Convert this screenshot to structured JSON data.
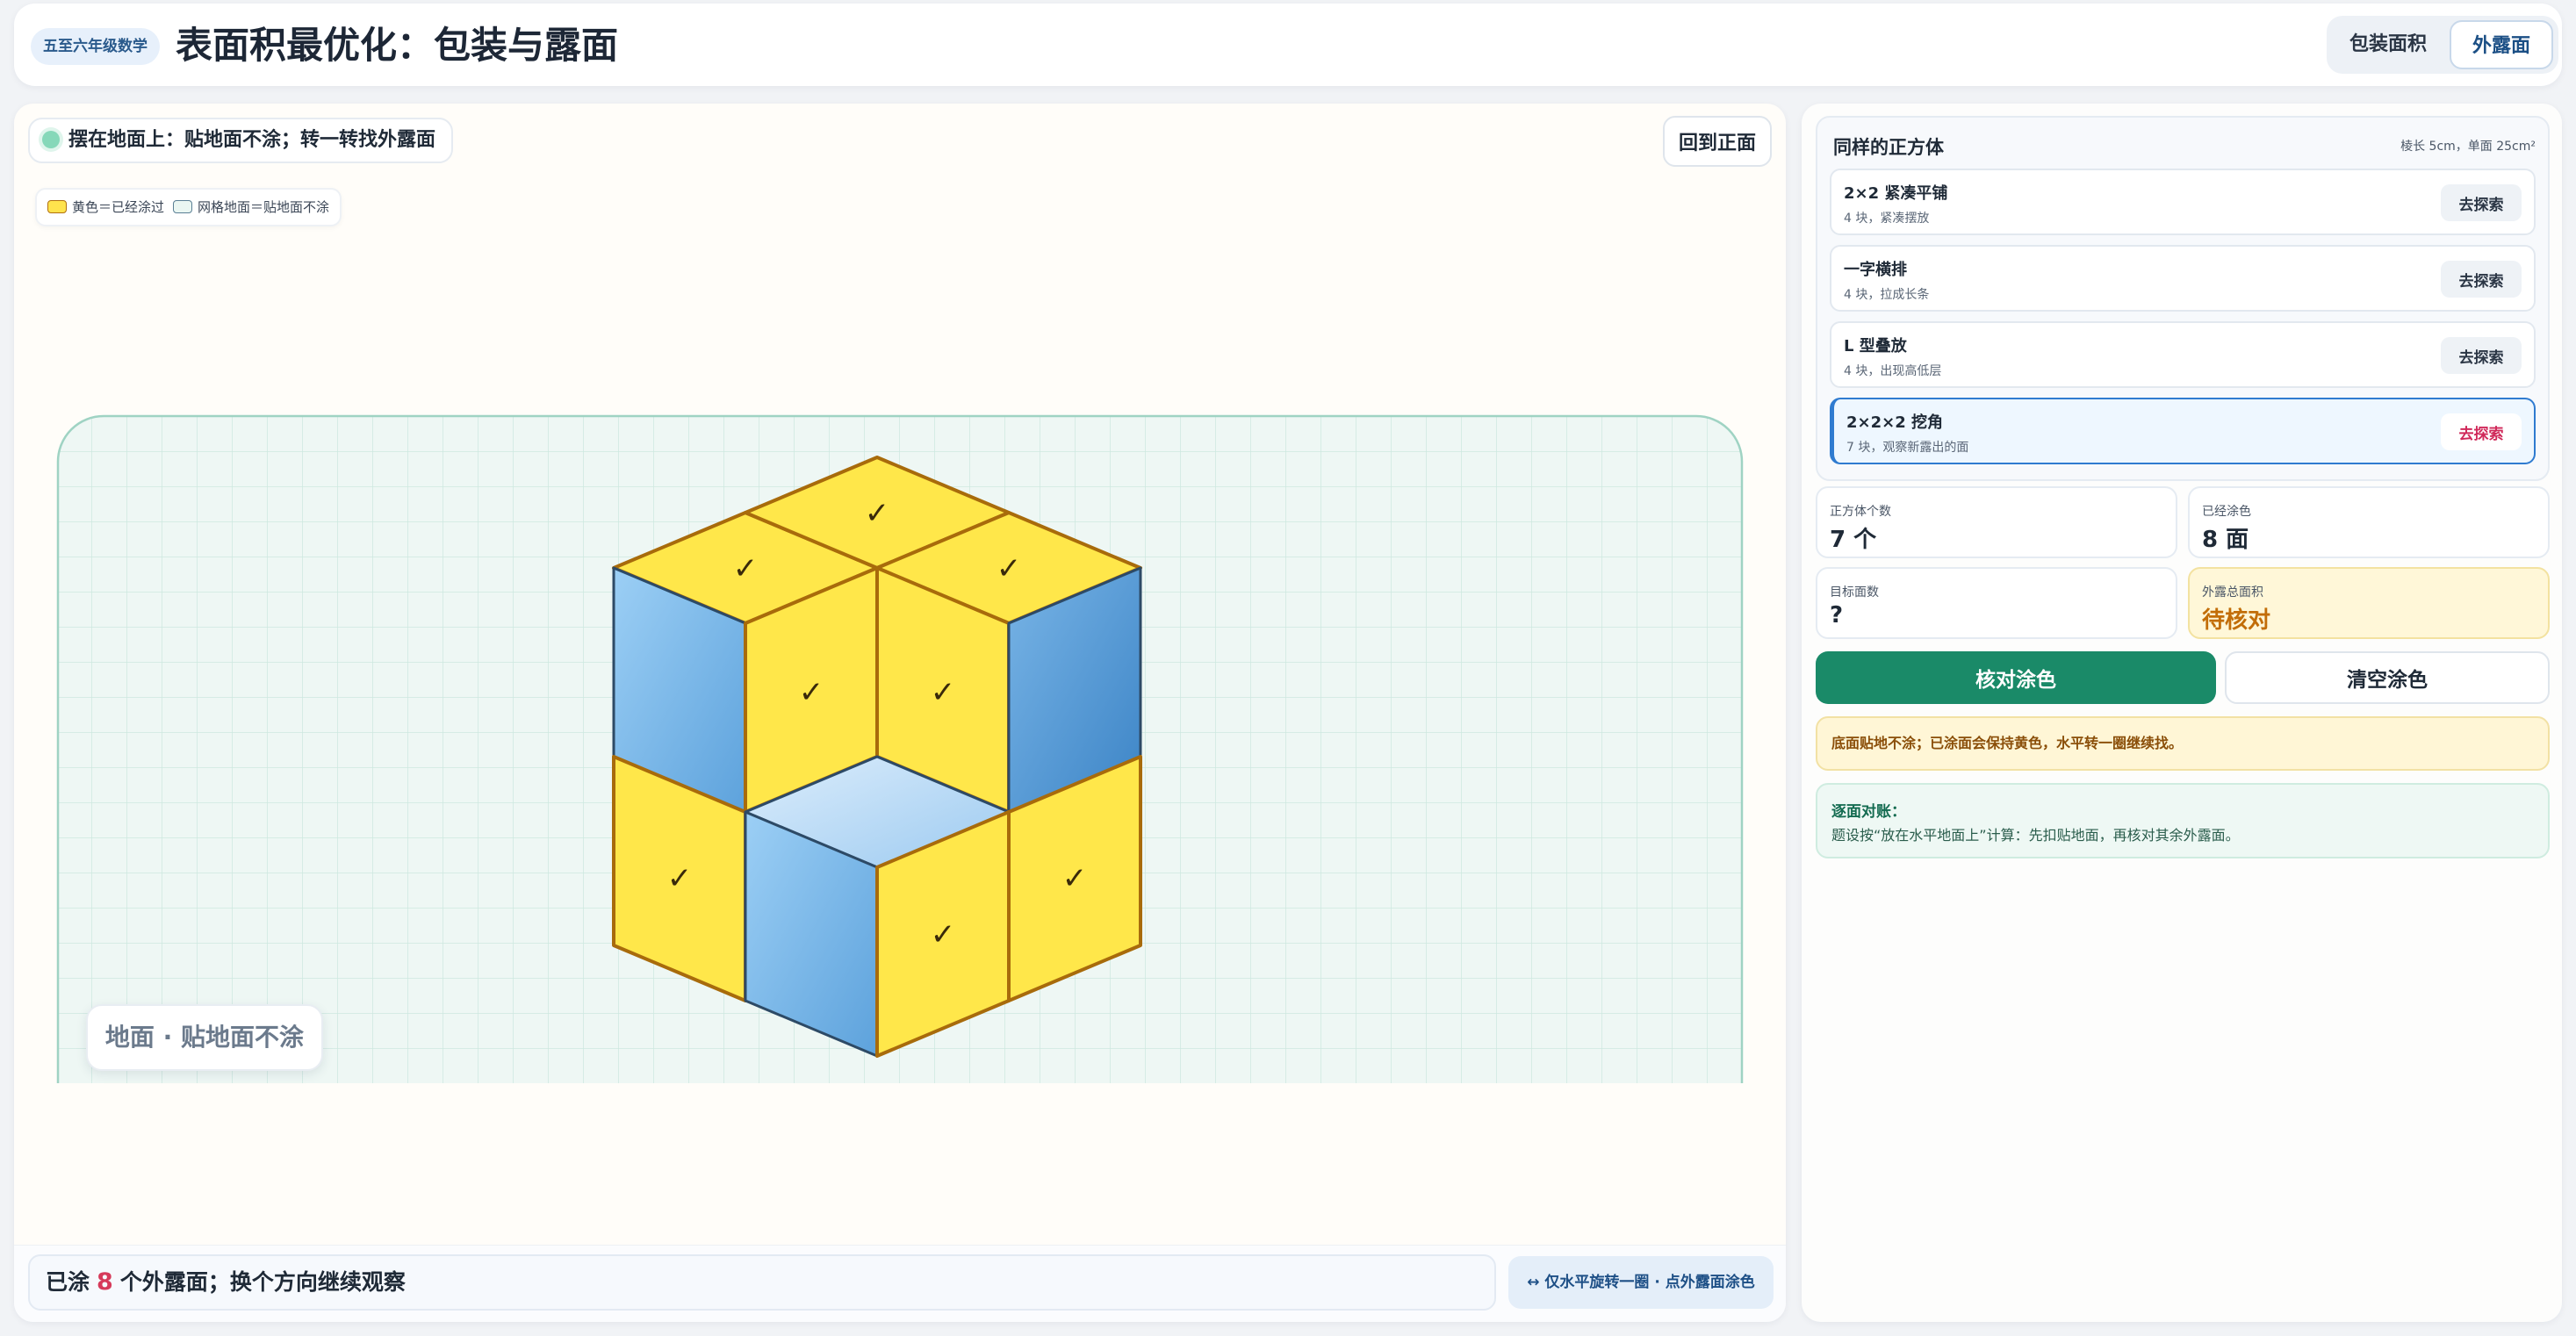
{
  "header": {
    "grade_badge": "五至六年级数学",
    "title": "表面积最优化：包装与露面",
    "modes": [
      {
        "label": "包装面积",
        "active": false
      },
      {
        "label": "外露面",
        "active": true
      }
    ]
  },
  "left": {
    "hint": "摆在地面上：贴地面不涂；转一转找外露面",
    "reset_label": "回到正面",
    "legend": {
      "yellow": "黄色＝已经涂过",
      "grid": "网格地面＝贴地面不涂"
    },
    "ground_label": "地面 · 贴地面不涂",
    "status": {
      "prefix": "已涂",
      "count": "8",
      "suffix": "个外露面；换个方向继续观察"
    },
    "rotate_hint": "↔ 仅水平旋转一圈 · 点外露面涂色"
  },
  "scene": {
    "check_mark": "✓",
    "colors": {
      "painted": "#ffe74a",
      "painted_edge": "#a86b0b",
      "blue_light": "#9ccdf3",
      "blue_dark": "#4a8fd0",
      "ground": "#eef7f4",
      "grid_line": "#cde8e0"
    }
  },
  "sidebar": {
    "list_title": "同样的正方体",
    "list_meta": "棱长 5cm，单面 25cm²",
    "shapes": [
      {
        "name": "2×2 紧凑平铺",
        "desc": "4 块，紧凑摆放",
        "button": "去探索",
        "active": false
      },
      {
        "name": "一字横排",
        "desc": "4 块，拉成长条",
        "button": "去探索",
        "active": false
      },
      {
        "name": "L 型叠放",
        "desc": "4 块，出现高低层",
        "button": "去探索",
        "active": false
      },
      {
        "name": "2×2×2 挖角",
        "desc": "7 块，观察新露出的面",
        "button": "去探索",
        "active": true
      }
    ],
    "stats": {
      "cube_count": {
        "label": "正方体个数",
        "value": "7 个"
      },
      "painted": {
        "label": "已经涂色",
        "value": "8 面"
      },
      "target": {
        "label": "目标面数",
        "value": "?"
      },
      "area": {
        "label": "外露总面积",
        "value": "待核对"
      }
    },
    "check_button": "核对涂色",
    "clear_button": "清空涂色",
    "notice": "底面贴地不涂；已涂面会保持黄色，水平转一圈继续找。",
    "ledger": {
      "title": "逐面对账：",
      "body": "题设按“放在水平地面上”计算：先扣贴地面，再核对其余外露面。"
    }
  }
}
